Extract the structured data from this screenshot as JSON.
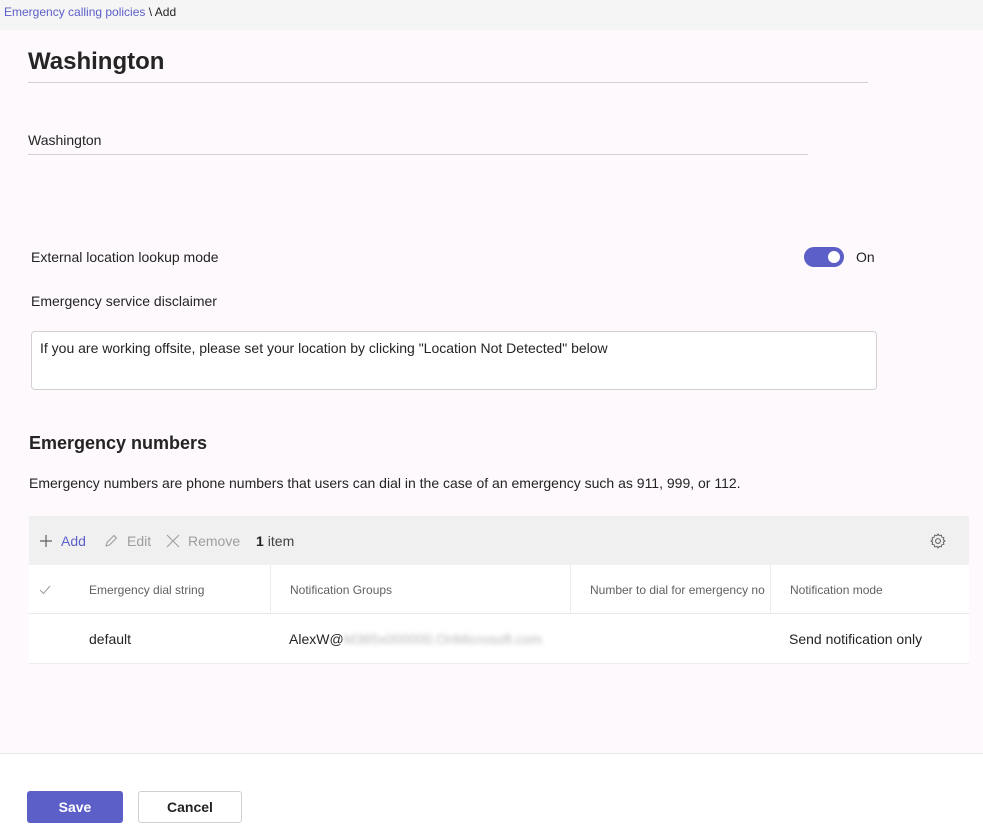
{
  "breadcrumb": {
    "parent": "Emergency calling policies",
    "separator": "\\",
    "current": "Add"
  },
  "page": {
    "title": "Washington",
    "name_value": "Washington"
  },
  "settings": {
    "lookup_label": "External location lookup mode",
    "lookup_state": "On",
    "lookup_on": true,
    "disclaimer_label": "Emergency service disclaimer",
    "disclaimer_value": "If you are working offsite, please set your location by clicking \"Location Not Detected\" below"
  },
  "emergency": {
    "title": "Emergency numbers",
    "description": "Emergency numbers are phone numbers that users can dial in the case of an emergency such as 911, 999, or 112."
  },
  "toolbar": {
    "add": "Add",
    "edit": "Edit",
    "remove": "Remove",
    "count_number": "1",
    "count_label": "item"
  },
  "table": {
    "headers": [
      "Emergency dial string",
      "Notification Groups",
      "Number to dial for emergency no",
      "Notification mode"
    ],
    "rows": [
      {
        "dial_string": "default",
        "group_visible": "AlexW@",
        "group_obscured": "M365x000000.OnMicrosoft.com",
        "number": "",
        "mode": "Send notification only"
      }
    ]
  },
  "footer": {
    "save": "Save",
    "cancel": "Cancel"
  },
  "colors": {
    "accent": "#5b5fc7",
    "background": "#fdf9fc"
  }
}
